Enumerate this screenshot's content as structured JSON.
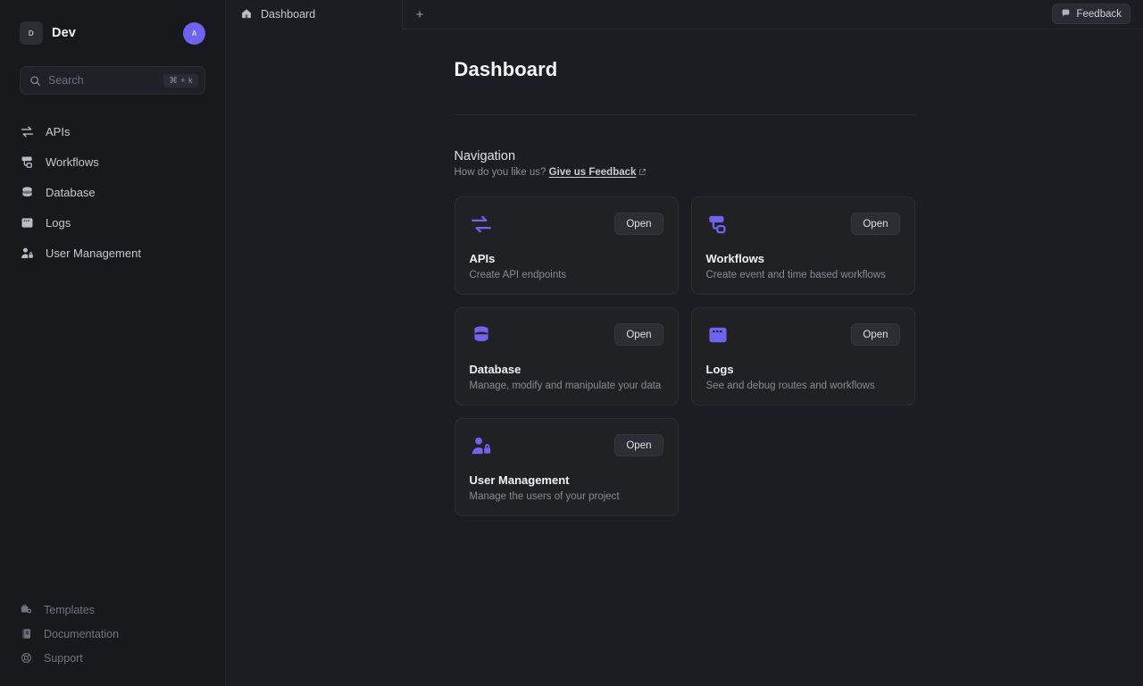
{
  "sidebar": {
    "project": {
      "badge": "D",
      "name": "Dev"
    },
    "avatar": {
      "initial": "A"
    },
    "search": {
      "placeholder": "Search",
      "shortcut": "⌘ + k"
    },
    "items": [
      {
        "label": "APIs",
        "icon": "arrows-exchange-icon"
      },
      {
        "label": "Workflows",
        "icon": "workflow-node-icon"
      },
      {
        "label": "Database",
        "icon": "database-icon"
      },
      {
        "label": "Logs",
        "icon": "logs-window-icon"
      },
      {
        "label": "User Management",
        "icon": "user-lock-icon"
      }
    ],
    "footer": [
      {
        "label": "Templates",
        "icon": "templates-icon"
      },
      {
        "label": "Documentation",
        "icon": "book-icon"
      },
      {
        "label": "Support",
        "icon": "lifebuoy-icon"
      }
    ]
  },
  "topbar": {
    "tab": {
      "label": "Dashboard",
      "icon": "home-icon"
    },
    "new_tab": "+",
    "feedback": {
      "label": "Feedback",
      "icon": "chat-bubble-icon"
    }
  },
  "main": {
    "title": "Dashboard",
    "section": {
      "heading": "Navigation",
      "sub_prefix": "How do you like us?",
      "link": "Give us Feedback"
    },
    "cards": [
      {
        "name": "APIs",
        "desc": "Create API endpoints",
        "button": "Open",
        "icon": "arrows-exchange-icon",
        "color": "#6f63f0"
      },
      {
        "name": "Workflows",
        "desc": "Create event and time based workflows",
        "button": "Open",
        "icon": "workflow-node-icon",
        "color": "#6f63f0"
      },
      {
        "name": "Database",
        "desc": "Manage, modify and manipulate your data",
        "button": "Open",
        "icon": "database-icon",
        "color": "#6f63f0"
      },
      {
        "name": "Logs",
        "desc": "See and debug routes and workflows",
        "button": "Open",
        "icon": "logs-window-icon",
        "color": "#6f63f0"
      },
      {
        "name": "User Management",
        "desc": "Manage the users of your project",
        "button": "Open",
        "icon": "user-lock-icon",
        "color": "#6f63f0"
      }
    ]
  },
  "colors": {
    "accent": "#6f63f0",
    "sidebar_bg": "#18191d",
    "main_bg": "#1c1d22",
    "card_bg": "#202125",
    "border": "#2c2e34"
  }
}
